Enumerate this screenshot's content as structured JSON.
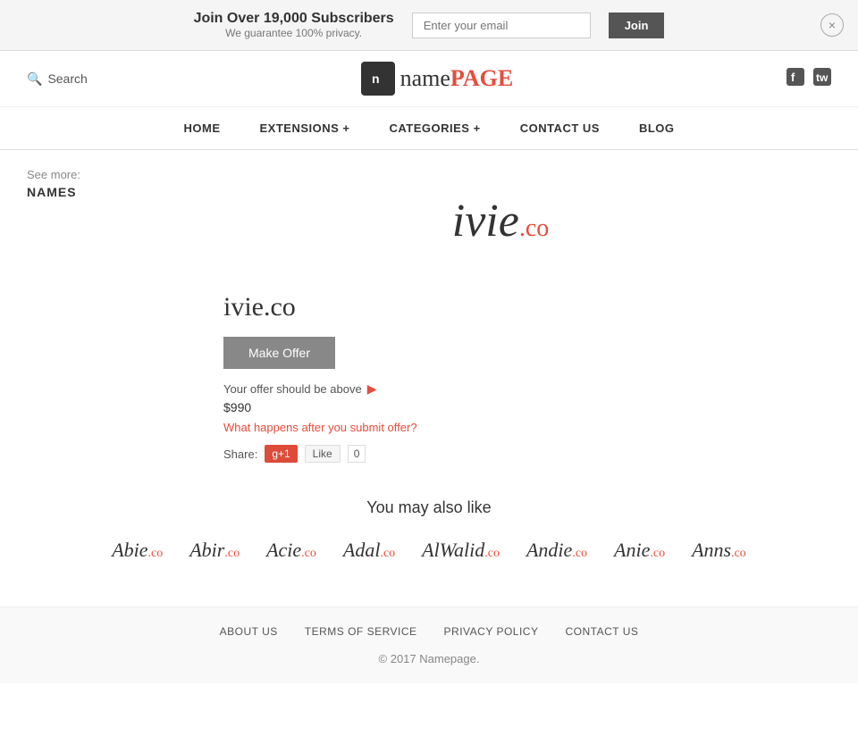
{
  "banner": {
    "title": "Join Over 19,000 Subscribers",
    "subtitle": "We guarantee 100% privacy.",
    "email_placeholder": "Enter your email",
    "join_label": "Join",
    "close_label": "×"
  },
  "header": {
    "search_label": "Search",
    "logo_icon": "n",
    "logo_name": "name",
    "logo_page": "PAGE",
    "facebook_icon": "f",
    "twitter_icon": "t"
  },
  "nav": {
    "items": [
      {
        "label": "HOME",
        "has_plus": false
      },
      {
        "label": "EXTENSIONS +",
        "has_plus": false
      },
      {
        "label": "CATEGORIES +",
        "has_plus": false
      },
      {
        "label": "CONTACT US",
        "has_plus": false
      },
      {
        "label": "BLOG",
        "has_plus": false
      }
    ]
  },
  "sidebar": {
    "see_more_label": "See more:",
    "category_link": "NAMES"
  },
  "domain": {
    "name": "ivie",
    "extension": ".co",
    "full": "ivie.co",
    "make_offer_label": "Make Offer",
    "offer_above_text": "Your offer should be above",
    "offer_price": "$990",
    "offer_link_text": "What happens after you submit offer?",
    "share_label": "Share:",
    "gplus_label": "g+1",
    "fb_label": "Like",
    "fb_count": "0"
  },
  "also_like": {
    "title": "You may also like",
    "items": [
      {
        "name": "Abie",
        "ext": ".co"
      },
      {
        "name": "Abir",
        "ext": ".co"
      },
      {
        "name": "Acie",
        "ext": ".co"
      },
      {
        "name": "Adal",
        "ext": ".co"
      },
      {
        "name": "AlWalid",
        "ext": ".co"
      },
      {
        "name": "Andie",
        "ext": ".co"
      },
      {
        "name": "Anie",
        "ext": ".co"
      },
      {
        "name": "Anns",
        "ext": ".co"
      }
    ]
  },
  "footer": {
    "links": [
      {
        "label": "ABOUT US"
      },
      {
        "label": "TERMS OF SERVICE"
      },
      {
        "label": "PRIVACY POLICY"
      },
      {
        "label": "CONTACT US"
      }
    ],
    "copyright": "© 2017 Namepage."
  }
}
